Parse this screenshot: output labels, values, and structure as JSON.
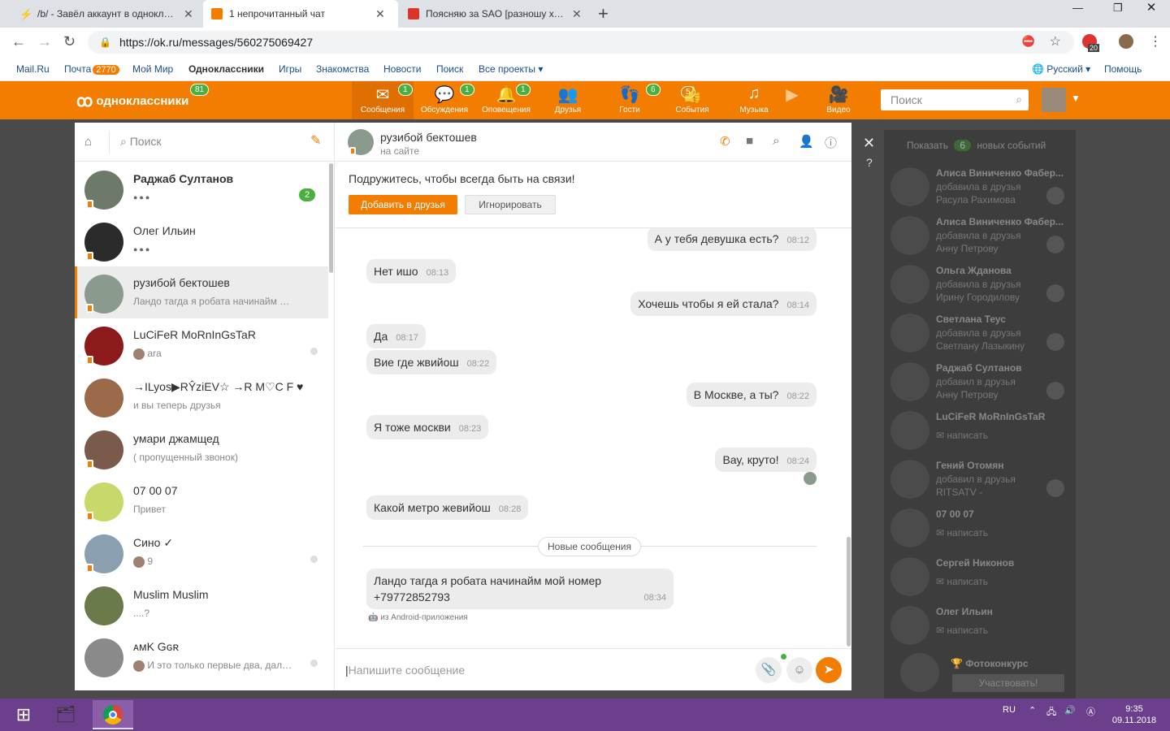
{
  "browser": {
    "tabs": [
      {
        "title": "/b/ - Завёл аккаунт в одноклассни",
        "favicon_color": "#f5a623",
        "active": false
      },
      {
        "title": "1 непрочитанный чат",
        "favicon_color": "#f27d00",
        "active": true
      },
      {
        "title": "Поясняю за SAO [разношу хейте",
        "favicon_color": "#d9352b",
        "active": false
      }
    ],
    "url": "https://ok.ru/messages/560275069427",
    "ext_badge": "20"
  },
  "portal": {
    "links": [
      "Mail.Ru",
      "Почта",
      "Мой Мир",
      "Одноклассники",
      "Игры",
      "Знакомства",
      "Новости",
      "Поиск",
      "Все проекты"
    ],
    "mail_badge": "2770",
    "lang": "Русский",
    "help": "Помощь"
  },
  "header": {
    "logo": "одноклассники",
    "logo_badge": "81",
    "nav": [
      {
        "label": "Сообщения",
        "icon": "envelope-icon",
        "badge": "1"
      },
      {
        "label": "Обсуждения",
        "icon": "chat-bubbles-icon",
        "badge": "1"
      },
      {
        "label": "Оповещения",
        "icon": "bell-icon",
        "badge": "1"
      },
      {
        "label": "Друзья",
        "icon": "friends-icon",
        "badge": ""
      },
      {
        "label": "Гости",
        "icon": "footprints-icon",
        "badge": "6"
      },
      {
        "label": "События",
        "icon": "like-icon",
        "badge": "5"
      },
      {
        "label": "Музыка",
        "icon": "music-note-icon",
        "badge": ""
      },
      {
        "label": "",
        "icon": "video-play-icon",
        "badge": ""
      },
      {
        "label": "Видео",
        "icon": "camera-icon",
        "badge": ""
      }
    ],
    "search_placeholder": "Поиск"
  },
  "chatlist": {
    "search_placeholder": "Поиск",
    "items": [
      {
        "name": "Раджаб Султанов",
        "preview": "●●●",
        "badge": "2",
        "bold": true,
        "avatar_color": "#6d7a6a"
      },
      {
        "name": "Олег Ильин",
        "preview": "●●●",
        "badge": "",
        "bold": false,
        "avatar_color": "#2b2b2b"
      },
      {
        "name": "рузибой бектошев",
        "preview": "Ландо тагда я робата начинайм мой номер",
        "badge": "",
        "bold": false,
        "avatar_color": "#8a9a8c"
      },
      {
        "name": "LuCiFeR MoRnInGsTaR",
        "preview": "ara",
        "badge": "",
        "bold": false,
        "avatar_color": "#8c1a1a"
      },
      {
        "name": "→ILyos▶RŶziEV☆ →R M♡C F ♥",
        "preview": "и вы теперь друзья",
        "badge": "",
        "bold": false,
        "avatar_color": "#9a6a4a"
      },
      {
        "name": "умари джамщед",
        "preview": "( пропущенный звонок)",
        "badge": "",
        "bold": false,
        "avatar_color": "#7a5a4a"
      },
      {
        "name": "07 00 07",
        "preview": "Привет",
        "badge": "",
        "bold": false,
        "avatar_color": "#c8d86a"
      },
      {
        "name": "Сино ✓",
        "preview": "9",
        "badge": "",
        "bold": false,
        "avatar_color": "#8aa0b0"
      },
      {
        "name": "Muslim Muslim",
        "preview": "....?",
        "badge": "",
        "bold": false,
        "avatar_color": "#6a7a4a"
      },
      {
        "name": "ᴀᴍK Gɢʀ",
        "preview": "И это только первые два, дальше",
        "badge": "",
        "bold": false,
        "avatar_color": "#8a8a8a"
      }
    ]
  },
  "conversation": {
    "name": "рузибой бектошев",
    "status": "на сайте",
    "befriend_text": "Подружитесь, чтобы всегда быть на связи!",
    "add_friend": "Добавить в друзья",
    "ignore": "Игнорировать",
    "messages": [
      {
        "text": "А у тебя девушка есть?",
        "time": "08:12",
        "out": true
      },
      {
        "text": "Нет ишо",
        "time": "08:13",
        "out": false
      },
      {
        "text": "Хочешь чтобы я ей стала?",
        "time": "08:14",
        "out": true
      },
      {
        "text": "Да",
        "time": "08:17",
        "out": false
      },
      {
        "text": "Вие где жвийош",
        "time": "08:22",
        "out": false
      },
      {
        "text": "В Москве, а ты?",
        "time": "08:22",
        "out": true
      },
      {
        "text": "Я тоже москви",
        "time": "08:23",
        "out": false
      },
      {
        "text": "Вау, круто!",
        "time": "08:24",
        "out": true
      },
      {
        "text": "Какой метро жевийош",
        "time": "08:28",
        "out": false
      }
    ],
    "new_label": "Новые сообщения",
    "last_line1": "Ландо тагда я робата начинайм мой номер",
    "last_line2": "+79772852793",
    "last_time": "08:34",
    "android_note": "из Android-приложения",
    "input_placeholder": "Напишите сообщение"
  },
  "events": {
    "header_pre": "Показать",
    "header_count": "6",
    "header_post": "новых событий",
    "items": [
      {
        "name": "Алиса Виниченко Фабер...",
        "l1": "добавила в друзья",
        "l2": "Расула Рахимова"
      },
      {
        "name": "Алиса Виниченко Фабер...",
        "l1": "добавила в друзья",
        "l2": "Анну Петрову"
      },
      {
        "name": "Ольга Жданова",
        "l1": "добавила в друзья",
        "l2": "Ирину Городилову"
      },
      {
        "name": "Светлана Теус",
        "l1": "добавила в друзья",
        "l2": "Светлану Лазыкину"
      },
      {
        "name": "Раджаб Султанов",
        "l1": "добавил в друзья",
        "l2": "Анну Петрову"
      },
      {
        "name": "LuCiFeR MoRnInGsTaR",
        "l1": "написать",
        "l2": ""
      },
      {
        "name": "Гений Отомян",
        "l1": "добавил в друзья",
        "l2": "RITSATV -"
      },
      {
        "name": "07 00 07",
        "l1": "написать",
        "l2": ""
      },
      {
        "name": "Сергей Никонов",
        "l1": "написать",
        "l2": ""
      },
      {
        "name": "Олег Ильин",
        "l1": "написать",
        "l2": ""
      }
    ],
    "photo_contest": "Фотоконкурс",
    "participate": "Участвовать!"
  },
  "taskbar": {
    "lang": "RU",
    "time": "9:35",
    "date": "09.11.2018"
  }
}
